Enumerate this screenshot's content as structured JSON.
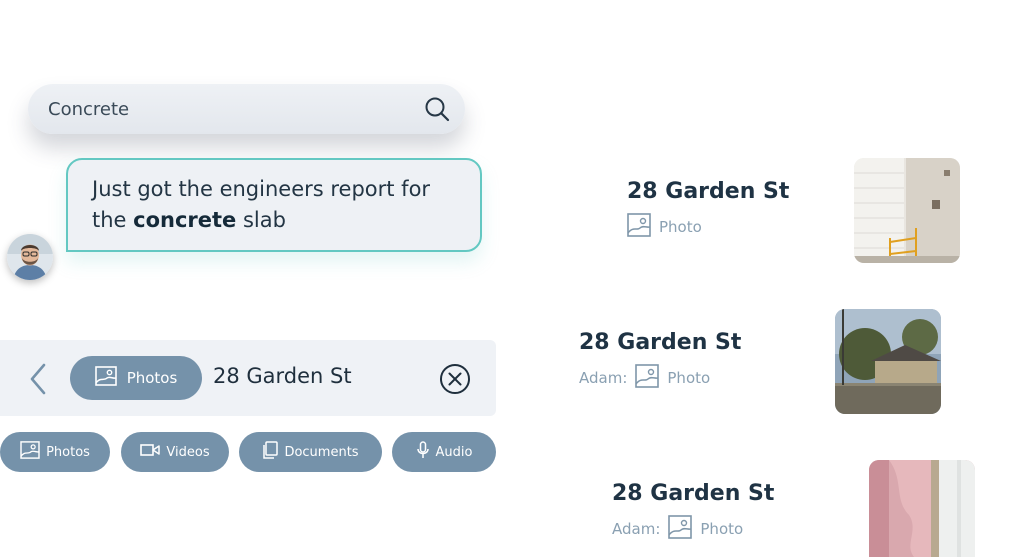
{
  "search": {
    "value": "Concrete"
  },
  "message": {
    "text_before": "Just got the engineers report for the ",
    "highlight": "concrete",
    "text_after": " slab"
  },
  "filter_bar": {
    "chip_label": "Photos",
    "query": "28 Garden St"
  },
  "filter_buttons": [
    "Photos",
    "Videos",
    "Documents",
    "Audio"
  ],
  "results": [
    {
      "title": "28 Garden St",
      "author": "",
      "type": "Photo"
    },
    {
      "title": "28 Garden St",
      "author": "Adam:",
      "type": "Photo"
    },
    {
      "title": "28 Garden St",
      "author": "Adam:",
      "type": "Photo"
    }
  ],
  "colors": {
    "accent": "#7592aa",
    "teal_border": "#63c8c2",
    "title": "#1f3344",
    "meta": "#8aa0b2"
  },
  "icons": [
    "search-icon",
    "chevron-left-icon",
    "image-icon",
    "close-circle-icon",
    "video-icon",
    "document-icon",
    "microphone-icon"
  ]
}
